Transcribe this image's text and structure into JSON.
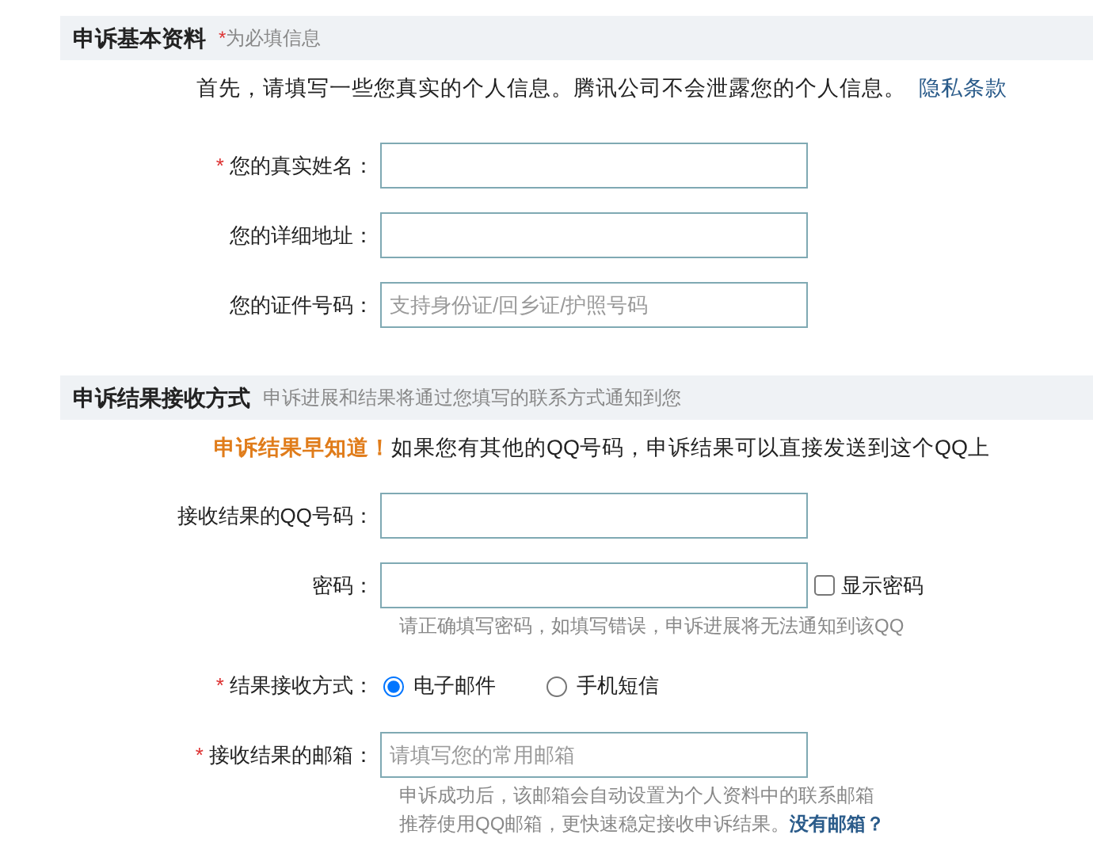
{
  "sections": [
    {
      "title": "申诉基本资料",
      "note_mark": "*",
      "note": "为必填信息",
      "intro": {
        "text": "首先，请填写一些您真实的个人信息。腾讯公司不会泄露您的个人信息。",
        "link": "隐私条款"
      },
      "fields": [
        {
          "kind": "text",
          "required_mark": "*",
          "label": "您的真实姓名："
        },
        {
          "kind": "text",
          "label": "您的详细地址："
        },
        {
          "kind": "text",
          "label": "您的证件号码：",
          "placeholder": "支持身份证/回乡证/护照号码"
        }
      ]
    },
    {
      "title": "申诉结果接收方式",
      "note": "申诉进展和结果将通过您填写的联系方式通知到您",
      "intro": {
        "lead": "申诉结果早知道！",
        "text": "如果您有其他的QQ号码，申诉结果可以直接发送到这个QQ上"
      },
      "fields": [
        {
          "kind": "text",
          "label": "接收结果的QQ号码："
        },
        {
          "kind": "password",
          "label": "密码：",
          "toggle": {
            "label": "显示密码",
            "checked": false
          },
          "hints": [
            {
              "text": "请正确填写密码，如填写错误，申诉进展将无法通知到该QQ"
            }
          ]
        },
        {
          "kind": "radio",
          "required_mark": "*",
          "label": "结果接收方式：",
          "options": [
            {
              "label": "电子邮件",
              "selected": true
            },
            {
              "label": "手机短信",
              "selected": false
            }
          ]
        },
        {
          "kind": "text",
          "required_mark": "*",
          "label": "接收结果的邮箱：",
          "placeholder": "请填写您的常用邮箱",
          "hints": [
            {
              "text": "申诉成功后，该邮箱会自动设置为个人资料中的联系邮箱"
            },
            {
              "text": "推荐使用QQ邮箱，更快速稳定接收申诉结果。",
              "link": "没有邮箱？"
            }
          ]
        }
      ]
    }
  ]
}
